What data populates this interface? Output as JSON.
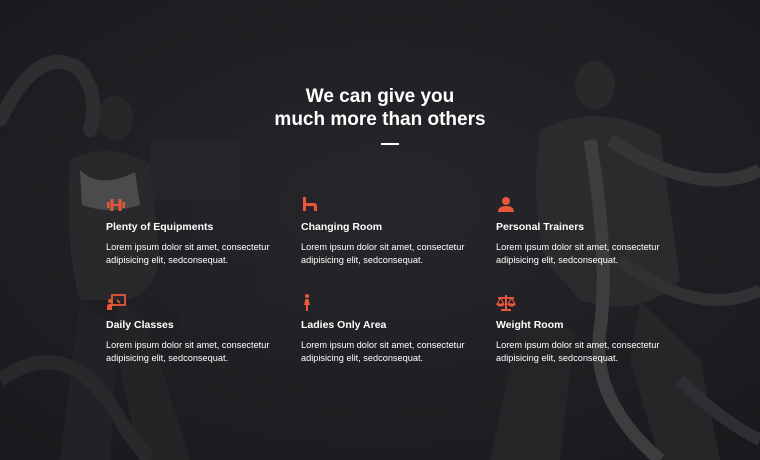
{
  "section": {
    "heading_line1": "We can give you",
    "heading_line2": "much more than others"
  },
  "colors": {
    "accent": "#e8573a",
    "text": "#ffffff",
    "background": "#26262a"
  },
  "features": [
    {
      "icon": "dumbbell-icon",
      "title": "Plenty of Equipments",
      "description": "Lorem ipsum dolor sit amet, consectetur adipisicing elit, sedconsequat."
    },
    {
      "icon": "changing-room-icon",
      "title": "Changing Room",
      "description": "Lorem ipsum dolor sit amet, consectetur adipisicing elit, sedconsequat."
    },
    {
      "icon": "user-icon",
      "title": "Personal Trainers",
      "description": "Lorem ipsum dolor sit amet, consectetur adipisicing elit, sedconsequat."
    },
    {
      "icon": "presentation-board-icon",
      "title": "Daily Classes",
      "description": "Lorem ipsum dolor sit amet, consectetur adipisicing elit, sedconsequat."
    },
    {
      "icon": "woman-icon",
      "title": "Ladies Only Area",
      "description": "Lorem ipsum dolor sit amet, consectetur adipisicing elit, sedconsequat."
    },
    {
      "icon": "scale-balance-icon",
      "title": "Weight Room",
      "description": "Lorem ipsum dolor sit amet, consectetur adipisicing elit, sedconsequat."
    }
  ]
}
